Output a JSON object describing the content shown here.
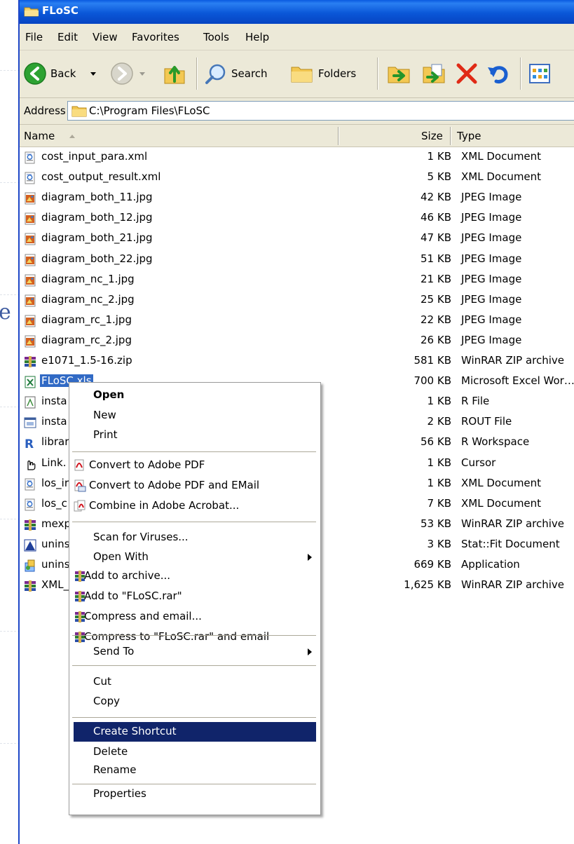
{
  "window": {
    "title": "FLoSC"
  },
  "background": {
    "partial_letter": "e"
  },
  "menu": [
    "File",
    "Edit",
    "View",
    "Favorites",
    "Tools",
    "Help"
  ],
  "toolbar": {
    "back_label": "Back",
    "search_label": "Search",
    "folders_label": "Folders"
  },
  "address": {
    "label": "Address",
    "path": "C:\\Program Files\\FLoSC"
  },
  "columns": {
    "name": "Name",
    "size": "Size",
    "type": "Type"
  },
  "files": [
    {
      "name": "cost_input_para.xml",
      "size": "1 KB",
      "type": "XML Document",
      "icon": "xml-file-icon"
    },
    {
      "name": "cost_output_result.xml",
      "size": "5 KB",
      "type": "XML Document",
      "icon": "xml-file-icon"
    },
    {
      "name": "diagram_both_11.jpg",
      "size": "42 KB",
      "type": "JPEG Image",
      "icon": "jpeg-file-icon"
    },
    {
      "name": "diagram_both_12.jpg",
      "size": "46 KB",
      "type": "JPEG Image",
      "icon": "jpeg-file-icon"
    },
    {
      "name": "diagram_both_21.jpg",
      "size": "47 KB",
      "type": "JPEG Image",
      "icon": "jpeg-file-icon"
    },
    {
      "name": "diagram_both_22.jpg",
      "size": "51 KB",
      "type": "JPEG Image",
      "icon": "jpeg-file-icon"
    },
    {
      "name": "diagram_nc_1.jpg",
      "size": "21 KB",
      "type": "JPEG Image",
      "icon": "jpeg-file-icon"
    },
    {
      "name": "diagram_nc_2.jpg",
      "size": "25 KB",
      "type": "JPEG Image",
      "icon": "jpeg-file-icon"
    },
    {
      "name": "diagram_rc_1.jpg",
      "size": "22 KB",
      "type": "JPEG Image",
      "icon": "jpeg-file-icon"
    },
    {
      "name": "diagram_rc_2.jpg",
      "size": "26 KB",
      "type": "JPEG Image",
      "icon": "jpeg-file-icon"
    },
    {
      "name": "e1071_1.5-16.zip",
      "size": "581 KB",
      "type": "WinRAR ZIP archive",
      "icon": "winrar-archive-icon"
    },
    {
      "name": "FLoSC.xls",
      "size": "700 KB",
      "type": "Microsoft Excel Wor…",
      "icon": "excel-file-icon"
    },
    {
      "name": "insta",
      "size": "1 KB",
      "type": "R File",
      "icon": "r-script-icon"
    },
    {
      "name": "insta",
      "size": "2 KB",
      "type": "ROUT File",
      "icon": "rout-file-icon"
    },
    {
      "name": "librar",
      "size": "56 KB",
      "type": "R Workspace",
      "icon": "r-workspace-icon"
    },
    {
      "name": "Link.",
      "size": "1 KB",
      "type": "Cursor",
      "icon": "hand-cursor-icon"
    },
    {
      "name": "los_ir",
      "size": "1 KB",
      "type": "XML Document",
      "icon": "xml-file-icon"
    },
    {
      "name": "los_c",
      "size": "7 KB",
      "type": "XML Document",
      "icon": "xml-file-icon"
    },
    {
      "name": "mexp",
      "size": "53 KB",
      "type": "WinRAR ZIP archive",
      "icon": "winrar-archive-icon"
    },
    {
      "name": "unins",
      "size": "3 KB",
      "type": "Stat::Fit Document",
      "icon": "statfit-file-icon"
    },
    {
      "name": "unins",
      "size": "669 KB",
      "type": "Application",
      "icon": "installer-app-icon"
    },
    {
      "name": "XML_",
      "size": "1,625 KB",
      "type": "WinRAR ZIP archive",
      "icon": "winrar-archive-icon"
    }
  ],
  "context_menu": {
    "open": "Open",
    "new": "New",
    "print": "Print",
    "convert_pdf": "Convert to Adobe PDF",
    "convert_pdf_email": "Convert to Adobe PDF and EMail",
    "combine_acrobat": "Combine in Adobe Acrobat...",
    "scan_viruses": "Scan for Viruses...",
    "open_with": "Open With",
    "add_archive": "Add to archive...",
    "add_rar": "Add to \"FLoSC.rar\"",
    "compress_email": "Compress and email...",
    "compress_rar_email": "Compress to \"FLoSC.rar\" and email",
    "send_to": "Send To",
    "cut": "Cut",
    "copy": "Copy",
    "create_shortcut": "Create Shortcut",
    "delete": "Delete",
    "rename": "Rename",
    "properties": "Properties"
  },
  "colors": {
    "titlebar": "#0a57d8",
    "selection": "#316ac5",
    "menu_highlight": "#10246a",
    "chrome": "#ece9d8"
  }
}
